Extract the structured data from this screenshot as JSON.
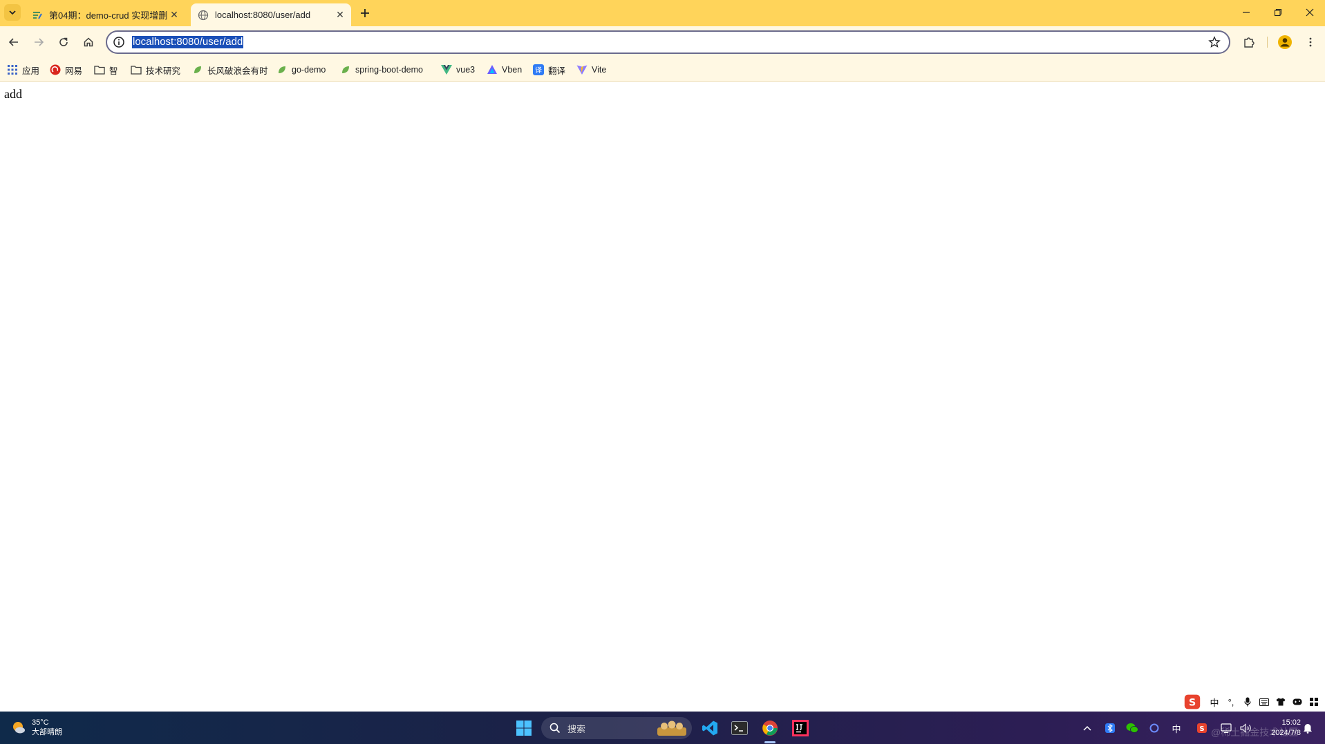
{
  "tabs": [
    {
      "title": "第04期：demo-crud 实现增删",
      "favicon": "blog-icon",
      "active": false
    },
    {
      "title": "localhost:8080/user/add",
      "favicon": "globe-icon",
      "active": true
    }
  ],
  "omnibox": {
    "url": "localhost:8080/user/add"
  },
  "bookmarks": [
    {
      "label": "应用",
      "icon": "apps-grid-icon"
    },
    {
      "label": "网易",
      "icon": "netease-icon"
    },
    {
      "label": "智",
      "icon": "folder-icon"
    },
    {
      "label": "技术研究",
      "icon": "folder-icon"
    },
    {
      "label": "长风破浪会有时",
      "icon": "leaf-icon"
    },
    {
      "label": "go-demo",
      "icon": "leaf-icon"
    },
    {
      "label": "spring-boot-demo",
      "icon": "leaf-icon"
    },
    {
      "label": "vue3",
      "icon": "vue-icon"
    },
    {
      "label": "Vben",
      "icon": "vben-icon"
    },
    {
      "label": "翻译",
      "icon": "translate-icon"
    },
    {
      "label": "Vite",
      "icon": "vite-icon"
    }
  ],
  "page": {
    "body_text": "add"
  },
  "ime": {
    "lang": "中"
  },
  "taskbar": {
    "weather_temp": "35°C",
    "weather_desc": "大部晴朗",
    "search_placeholder": "搜索",
    "tray_lang": "中",
    "time": "15:02",
    "date": "2024/7/8",
    "watermark": "@稀土掘金技术社区"
  },
  "colors": {
    "tabstrip": "#ffd45a",
    "toolbar": "#fff8e3",
    "url_highlight": "#1a4fb8"
  }
}
